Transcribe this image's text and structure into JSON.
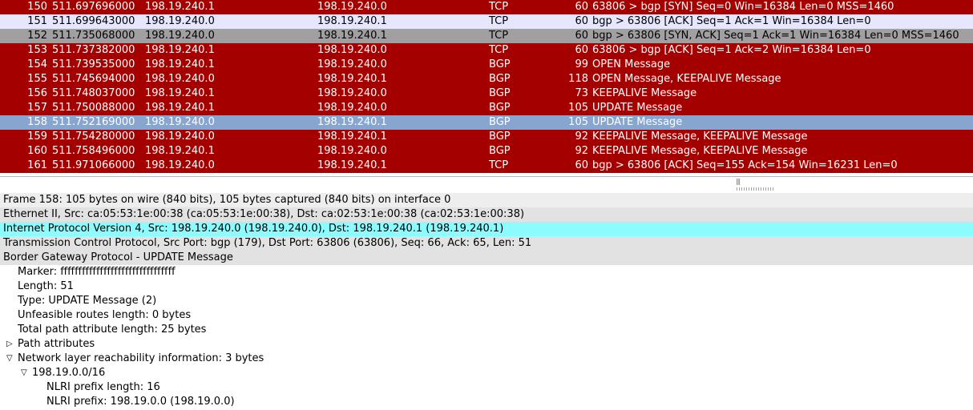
{
  "packet_list": {
    "rows": [
      {
        "no": "150",
        "time": "511.697696000",
        "src": "198.19.240.1",
        "dst": "198.19.240.0",
        "proto": "TCP",
        "len": "60",
        "info": "63806 > bgp [SYN] Seq=0 Win=16384 Len=0 MSS=1460",
        "bg": "#a40000",
        "fg": "#ffffff"
      },
      {
        "no": "151",
        "time": "511.699643000",
        "src": "198.19.240.0",
        "dst": "198.19.240.1",
        "proto": "TCP",
        "len": "60",
        "info": "bgp > 63806 [ACK] Seq=1 Ack=1 Win=16384 Len=0",
        "bg": "#e7e6ff",
        "fg": "#000000"
      },
      {
        "no": "152",
        "time": "511.735068000",
        "src": "198.19.240.0",
        "dst": "198.19.240.1",
        "proto": "TCP",
        "len": "60",
        "info": "bgp > 63806 [SYN, ACK] Seq=1 Ack=1 Win=16384 Len=0 MSS=1460",
        "bg": "#a0a0a0",
        "fg": "#000000"
      },
      {
        "no": "153",
        "time": "511.737382000",
        "src": "198.19.240.1",
        "dst": "198.19.240.0",
        "proto": "TCP",
        "len": "60",
        "info": "63806 > bgp [ACK] Seq=1 Ack=2 Win=16384 Len=0",
        "bg": "#a40000",
        "fg": "#ffffff"
      },
      {
        "no": "154",
        "time": "511.739535000",
        "src": "198.19.240.1",
        "dst": "198.19.240.0",
        "proto": "BGP",
        "len": "99",
        "info": "OPEN Message",
        "bg": "#a40000",
        "fg": "#ffffff"
      },
      {
        "no": "155",
        "time": "511.745694000",
        "src": "198.19.240.0",
        "dst": "198.19.240.1",
        "proto": "BGP",
        "len": "118",
        "info": "OPEN Message, KEEPALIVE Message",
        "bg": "#a40000",
        "fg": "#ffffff"
      },
      {
        "no": "156",
        "time": "511.748037000",
        "src": "198.19.240.1",
        "dst": "198.19.240.0",
        "proto": "BGP",
        "len": "73",
        "info": "KEEPALIVE Message",
        "bg": "#a40000",
        "fg": "#ffffff"
      },
      {
        "no": "157",
        "time": "511.750088000",
        "src": "198.19.240.1",
        "dst": "198.19.240.0",
        "proto": "BGP",
        "len": "105",
        "info": "UPDATE Message",
        "bg": "#a40000",
        "fg": "#ffffff"
      },
      {
        "no": "158",
        "time": "511.752169000",
        "src": "198.19.240.0",
        "dst": "198.19.240.1",
        "proto": "BGP",
        "len": "105",
        "info": "UPDATE Message",
        "bg": "#87a5cf",
        "fg": "#ffffff",
        "selected": true
      },
      {
        "no": "159",
        "time": "511.754280000",
        "src": "198.19.240.0",
        "dst": "198.19.240.1",
        "proto": "BGP",
        "len": "92",
        "info": "KEEPALIVE Message, KEEPALIVE Message",
        "bg": "#a40000",
        "fg": "#ffffff"
      },
      {
        "no": "160",
        "time": "511.758496000",
        "src": "198.19.240.1",
        "dst": "198.19.240.0",
        "proto": "BGP",
        "len": "92",
        "info": "KEEPALIVE Message, KEEPALIVE Message",
        "bg": "#a40000",
        "fg": "#ffffff"
      },
      {
        "no": "161",
        "time": "511.971066000",
        "src": "198.19.240.0",
        "dst": "198.19.240.1",
        "proto": "TCP",
        "len": "60",
        "info": "bgp > 63806 [ACK] Seq=155 Ack=154 Win=16231 Len=0",
        "bg": "#a40000",
        "fg": "#ffffff"
      }
    ]
  },
  "details": {
    "rows": [
      {
        "text": "Frame 158: 105 bytes on wire (840 bits), 105 bytes captured (840 bits) on interface 0",
        "level": 0,
        "toggle": "",
        "bg": "#eeeeee",
        "icon": ""
      },
      {
        "text": "Ethernet II, Src: ca:05:53:1e:00:38 (ca:05:53:1e:00:38), Dst: ca:02:53:1e:00:38 (ca:02:53:1e:00:38)",
        "level": 0,
        "toggle": "",
        "bg": "#e2e2e2",
        "icon": ""
      },
      {
        "text": "Internet Protocol Version 4, Src: 198.19.240.0 (198.19.240.0), Dst: 198.19.240.1 (198.19.240.1)",
        "level": 0,
        "toggle": "",
        "bg": "#8cfcff",
        "icon": ""
      },
      {
        "text": "Transmission Control Protocol, Src Port: bgp (179), Dst Port: 63806 (63806), Seq: 66, Ack: 65, Len: 51",
        "level": 0,
        "toggle": "",
        "bg": "#e2e2e2",
        "icon": ""
      },
      {
        "text": "Border Gateway Protocol - UPDATE Message",
        "level": 0,
        "toggle": "",
        "bg": "#e2e2e2",
        "icon": ""
      },
      {
        "text": "Marker: ffffffffffffffffffffffffffffffff",
        "level": 1,
        "toggle": "",
        "bg": "#ffffff",
        "icon": ""
      },
      {
        "text": "Length: 51",
        "level": 1,
        "toggle": "",
        "bg": "#ffffff",
        "icon": ""
      },
      {
        "text": "Type: UPDATE Message (2)",
        "level": 1,
        "toggle": "",
        "bg": "#ffffff",
        "icon": ""
      },
      {
        "text": "Unfeasible routes length: 0 bytes",
        "level": 1,
        "toggle": "",
        "bg": "#ffffff",
        "icon": ""
      },
      {
        "text": "Total path attribute length: 25 bytes",
        "level": 1,
        "toggle": "",
        "bg": "#ffffff",
        "icon": ""
      },
      {
        "text": "Path attributes",
        "level": 1,
        "toggle": "collapsed",
        "bg": "#ffffff",
        "icon": "expand-arrow-icon"
      },
      {
        "text": "Network layer reachability information: 3 bytes",
        "level": 1,
        "toggle": "expanded",
        "bg": "#ffffff",
        "icon": "collapse-arrow-icon"
      },
      {
        "text": "198.19.0.0/16",
        "level": 2,
        "toggle": "expanded",
        "bg": "#ffffff",
        "icon": "collapse-arrow-icon"
      },
      {
        "text": "NLRI prefix length: 16",
        "level": 3,
        "toggle": "",
        "bg": "#ffffff",
        "icon": ""
      },
      {
        "text": "NLRI prefix: 198.19.0.0 (198.19.0.0)",
        "level": 3,
        "toggle": "",
        "bg": "#ffffff",
        "icon": ""
      }
    ]
  }
}
